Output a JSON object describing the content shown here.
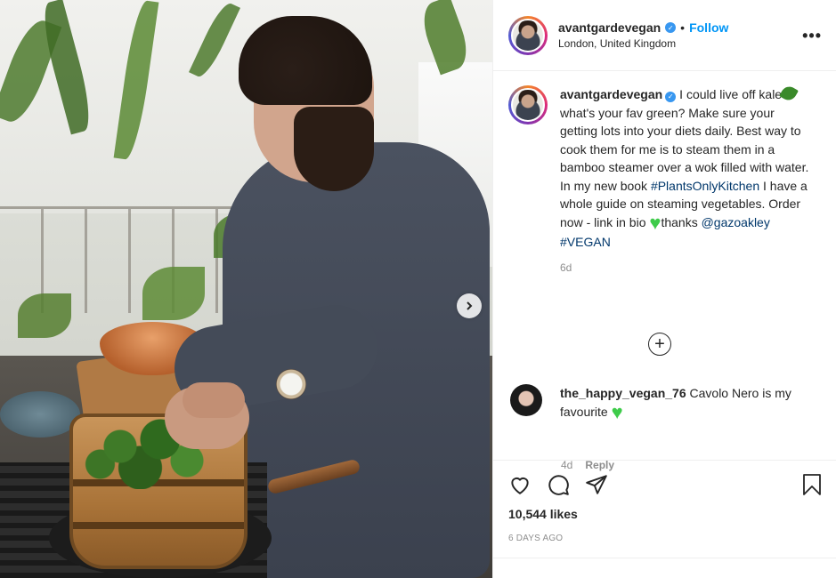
{
  "post": {
    "username": "avantgardevegan",
    "follow_label": "Follow",
    "separator": "•",
    "location": "London, United Kingdom",
    "more_label": "•••"
  },
  "caption": {
    "username": "avantgardevegan",
    "text_1": "I could live off kale",
    "text_2": " what's your fav green? Make sure your getting lots into your diets daily. Best way to cook them for me is to steam them in a bamboo steamer over a wok filled with water. In my new book ",
    "hashtag_book": "#PlantsOnlyKitchen",
    "text_3": " I have a whole guide on steaming vegetables. Order now - link in bio ",
    "text_4": "thanks ",
    "mention": "@gazoakley",
    "hashtag_vegan": "#VEGAN",
    "age": "6d"
  },
  "comment": {
    "username": "the_happy_vegan_76",
    "text": "Cavolo Nero is my favourite",
    "age": "4d",
    "reply_label": "Reply"
  },
  "load_more_label": "+",
  "likes_label": "10,544 likes",
  "date_label": "6 DAYS AGO",
  "icons": [
    "heart-icon",
    "comment-icon",
    "share-icon",
    "bookmark-icon",
    "chevron-right-icon",
    "plus-circle-icon",
    "verified-badge-icon"
  ],
  "colors": {
    "link": "#0095f6",
    "hashtag": "#00376b",
    "muted": "#8e8e8e",
    "verified": "#3897f0"
  }
}
